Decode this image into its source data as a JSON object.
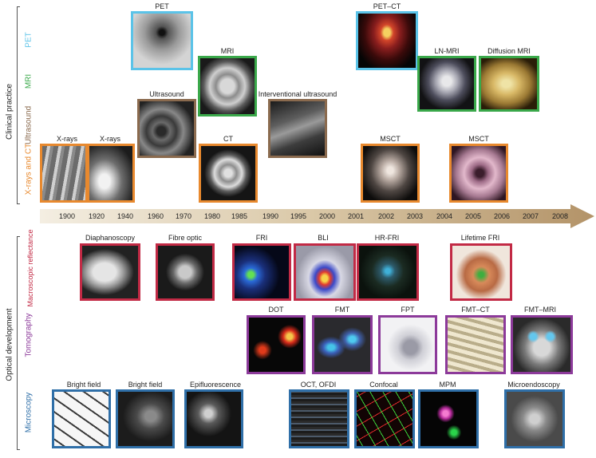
{
  "sections": {
    "clinical": "Clinical practice",
    "optical": "Optical development"
  },
  "rows": {
    "pet": {
      "label": "PET",
      "color": "#5bc3e8"
    },
    "mri": {
      "label": "MRI",
      "color": "#3aa84a"
    },
    "us": {
      "label": "Ultrasound",
      "color": "#8a6a4e"
    },
    "xct": {
      "label": "X-rays and CT",
      "color": "#e8892e"
    },
    "macro": {
      "label": "Macroscopic reflectance",
      "color": "#c22a45"
    },
    "tomo": {
      "label": "Tomography",
      "color": "#8c3a9a"
    },
    "micro": {
      "label": "Microscopy",
      "color": "#2f6fa8"
    }
  },
  "years": [
    "1900",
    "1920",
    "1940",
    "1960",
    "1970",
    "1980",
    "1985",
    "1990",
    "1995",
    "2000",
    "2001",
    "2002",
    "2003",
    "2004",
    "2005",
    "2006",
    "2007",
    "2008"
  ],
  "clinical_items": {
    "pet": "PET",
    "mri": "MRI",
    "ultrasound": "Ultrasound",
    "interventional_ultrasound": "Interventional ultrasound",
    "xray1": "X-rays",
    "xray2": "X-rays",
    "ct": "CT",
    "petct": "PET–CT",
    "lnmri": "LN-MRI",
    "diffusion_mri": "Diffusion MRI",
    "msct1": "MSCT",
    "msct2": "MSCT"
  },
  "optical_items": {
    "diaphanoscopy": "Diaphanoscopy",
    "fibre_optic": "Fibre optic",
    "fri": "FRI",
    "bli": "BLI",
    "hrfri": "HR-FRI",
    "lifetime_fri": "Lifetime FRI",
    "dot": "DOT",
    "fmt": "FMT",
    "fpt": "FPT",
    "fmtct": "FMT–CT",
    "fmtmri": "FMT–MRI",
    "bright_field1": "Bright field",
    "bright_field2": "Bright field",
    "epifluorescence": "Epifluorescence",
    "oct": "OCT, OFDI",
    "confocal": "Confocal",
    "mpm": "MPM",
    "microendoscopy": "Microendoscopy"
  }
}
